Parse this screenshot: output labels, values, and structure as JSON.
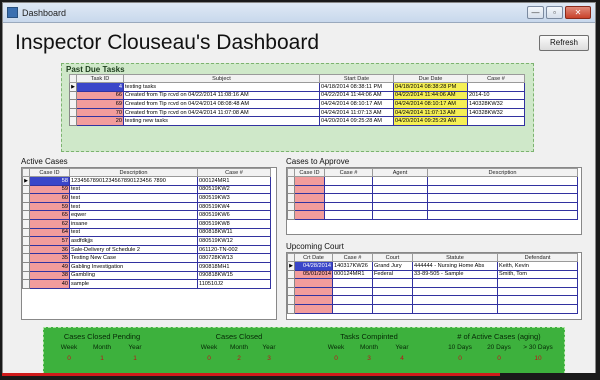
{
  "window": {
    "title": "Dashboard",
    "controls": [
      "—",
      "▫",
      "✕"
    ]
  },
  "page_title": "Inspector Clouseau's Dashboard",
  "refresh_label": "Refresh",
  "past_due": {
    "header": "Past Due Tasks",
    "columns": [
      "Task ID",
      "Subject",
      "Start Date",
      "Due Date",
      "Case #"
    ],
    "rows": [
      {
        "sel": "▶",
        "id": "4",
        "subject": "testing tasks",
        "start": "04/18/2014 08:38:11 PM",
        "due": "04/18/2014 08:38:28 PM",
        "case": ""
      },
      {
        "sel": "",
        "id": "66",
        "subject": "Created from Tip rcvd on 04/22/2014 11:08:16 AM",
        "start": "04/22/2014 11:44:06 AM",
        "due": "04/22/2014 11:44:06 AM",
        "case": "2014-10"
      },
      {
        "sel": "",
        "id": "69",
        "subject": "Created from Tip rcvd on 04/24/2014 08:08:48 AM",
        "start": "04/24/2014 08:10:17 AM",
        "due": "04/24/2014 08:10:17 AM",
        "case": "140328KW32"
      },
      {
        "sel": "",
        "id": "70",
        "subject": "Created from Tip rcvd on 04/24/2014 11:07:08 AM",
        "start": "04/24/2014 11:07:13 AM",
        "due": "04/24/2014 11:07:13 AM",
        "case": "140328KW32"
      },
      {
        "sel": "",
        "id": "20",
        "subject": "testing new tasks",
        "start": "04/20/2014 09:25:28 AM",
        "due": "04/20/2014 09:25:29 AM",
        "case": ""
      }
    ]
  },
  "active_cases": {
    "label": "Active Cases",
    "columns": [
      "Case ID",
      "Description",
      "Case #"
    ],
    "rows": [
      {
        "sel": "▶",
        "id": "58",
        "desc": "12345678901234567890123456 7890",
        "case": "000124MR1"
      },
      {
        "sel": "",
        "id": "59",
        "desc": "test",
        "case": "080519KW2"
      },
      {
        "sel": "",
        "id": "60",
        "desc": "test",
        "case": "080519KW3"
      },
      {
        "sel": "",
        "id": "59",
        "desc": "test",
        "case": "080519KW4"
      },
      {
        "sel": "",
        "id": "65",
        "desc": "eqwer",
        "case": "080519KW6"
      },
      {
        "sel": "",
        "id": "62",
        "desc": "insane",
        "case": "080519KW8"
      },
      {
        "sel": "",
        "id": "64",
        "desc": "test",
        "case": "080818KW11"
      },
      {
        "sel": "",
        "id": "57",
        "desc": "asdfdkjjs",
        "case": "080519KW12"
      },
      {
        "sel": "",
        "id": "36",
        "desc": "Sale-Delivery of Schedule 2",
        "case": "061120-TN-002"
      },
      {
        "sel": "",
        "id": "35",
        "desc": "Testing New Case",
        "case": "080728KW13"
      },
      {
        "sel": "",
        "id": "49",
        "desc": "Gabling Investigation",
        "case": "090818MH1"
      },
      {
        "sel": "",
        "id": "38",
        "desc": "Gambling",
        "case": "090818KW15"
      },
      {
        "sel": "",
        "id": "40",
        "desc": "sample",
        "case": "110510J2"
      }
    ]
  },
  "cases_to_approve": {
    "label": "Cases to Approve",
    "columns": [
      "Case ID",
      "Case #",
      "Agent",
      "Description"
    ],
    "empty_rows": 5
  },
  "upcoming_court": {
    "label": "Upcoming Court",
    "columns": [
      "Crt Date",
      "Case #",
      "Court",
      "Statute",
      "Defendant"
    ],
    "rows": [
      {
        "sel": "▶",
        "date": "04/28/2014",
        "case": "140317KW26",
        "court": "Grand Jury",
        "statute": "444444 - Nursing Home Abs",
        "defendant": "Keith, Kevin"
      },
      {
        "sel": "",
        "date": "05/01/2014",
        "case": "000124MR1",
        "court": "Federal",
        "statute": "33-89-505 - Sample",
        "defendant": "Smith, Tom"
      }
    ],
    "empty_rows": 4
  },
  "stats": {
    "groups": [
      {
        "title": "Cases Closed Pending",
        "labels": [
          "Week",
          "Month",
          "Year"
        ],
        "values": [
          "0",
          "1",
          "1"
        ]
      },
      {
        "title": "Cases Closed",
        "labels": [
          "Week",
          "Month",
          "Year"
        ],
        "values": [
          "0",
          "2",
          "3"
        ]
      },
      {
        "title": "Tasks Compinted",
        "labels": [
          "Week",
          "Month",
          "Year"
        ],
        "values": [
          "0",
          "3",
          "4"
        ]
      },
      {
        "title": "# of Active Cases (aging)",
        "labels": [
          "10 Days",
          "20 Days",
          "> 30 Days"
        ],
        "values": [
          "0",
          "0",
          "10"
        ]
      }
    ]
  },
  "colors": {
    "id_cell": "#f29c9c",
    "due_highlight": "#f5ef54",
    "selected_cell": "#3a46c9",
    "past_due_bg": "#cfe8c9",
    "stats_bg": "#3db13d",
    "stat_value": "#c0121a"
  }
}
